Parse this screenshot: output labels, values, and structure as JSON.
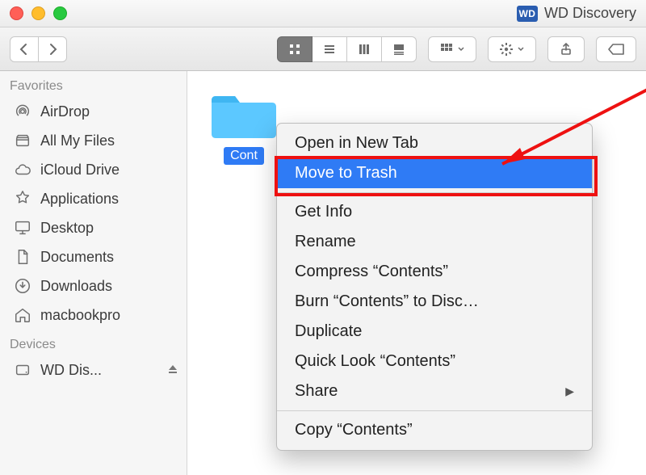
{
  "window": {
    "app_icon_text": "WD",
    "title": "WD Discovery"
  },
  "sidebar": {
    "headers": {
      "favorites": "Favorites",
      "devices": "Devices"
    },
    "favorites": [
      {
        "label": "AirDrop"
      },
      {
        "label": "All My Files"
      },
      {
        "label": "iCloud Drive"
      },
      {
        "label": "Applications"
      },
      {
        "label": "Desktop"
      },
      {
        "label": "Documents"
      },
      {
        "label": "Downloads"
      },
      {
        "label": "macbookpro"
      }
    ],
    "devices": [
      {
        "label": "WD Dis...",
        "ejectable": true
      }
    ]
  },
  "content": {
    "selected_folder_label": "Cont"
  },
  "context_menu": {
    "items": [
      {
        "label": "Open in New Tab"
      },
      {
        "label": "Move to Trash",
        "hovered": true,
        "highlighted": true
      },
      {
        "sep": true
      },
      {
        "label": "Get Info"
      },
      {
        "label": "Rename"
      },
      {
        "label": "Compress “Contents”"
      },
      {
        "label": "Burn “Contents” to Disc…"
      },
      {
        "label": "Duplicate"
      },
      {
        "label": "Quick Look “Contents”"
      },
      {
        "label": "Share",
        "submenu": true
      },
      {
        "sep": true
      },
      {
        "label": "Copy “Contents”"
      }
    ]
  }
}
